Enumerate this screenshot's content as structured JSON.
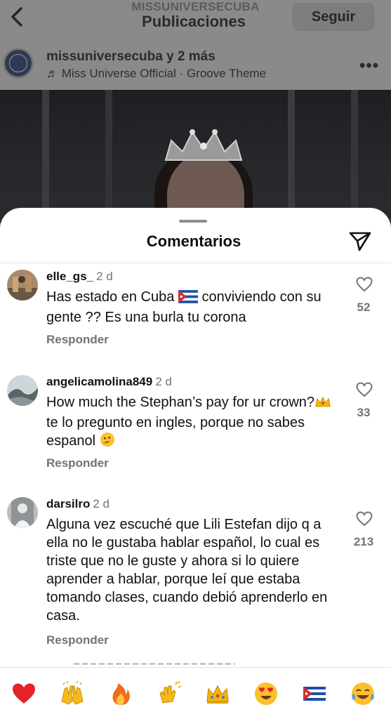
{
  "header": {
    "account_small": "MISSUNIVERSECUBA",
    "title": "Publicaciones",
    "follow_label": "Seguir"
  },
  "post": {
    "username": "missuniversecuba y 2 más",
    "music_note": "♬",
    "music": "Miss Universe Official · Groove Theme",
    "more": "•••"
  },
  "sheet": {
    "title": "Comentarios"
  },
  "comments": [
    {
      "user": "elle_gs_",
      "time": "2 d",
      "text_a": "Has estado en Cuba ",
      "text_b": " conviviendo con su gente ?? Es una burla tu corona",
      "likes": "52",
      "reply": "Responder"
    },
    {
      "user": "angelicamolina849",
      "time": "2 d",
      "text_a": "How much the Stephan’s pay for ur crown?",
      "text_b": " te lo pregunto en ingles, porque no sabes espanol ",
      "likes": "33",
      "reply": "Responder"
    },
    {
      "user": "darsilro",
      "time": "2 d",
      "text_a": "Alguna vez escuché que Lili Estefan dijo q a ella no le gustaba hablar español, lo cual es triste que no le guste y ahora si lo quiere aprender a hablar, porque leí que estaba tomando clases, cuando debió aprenderlo en casa.",
      "likes": "213",
      "reply": "Responder"
    }
  ],
  "reactions": [
    "red-heart",
    "raising-hands",
    "fire",
    "clapping-hands",
    "crown",
    "heart-eyes",
    "cuba-flag",
    "tears-of-joy"
  ],
  "colors": {
    "accent_text": "#111111",
    "muted": "#737373",
    "heart": "#e3242b"
  }
}
